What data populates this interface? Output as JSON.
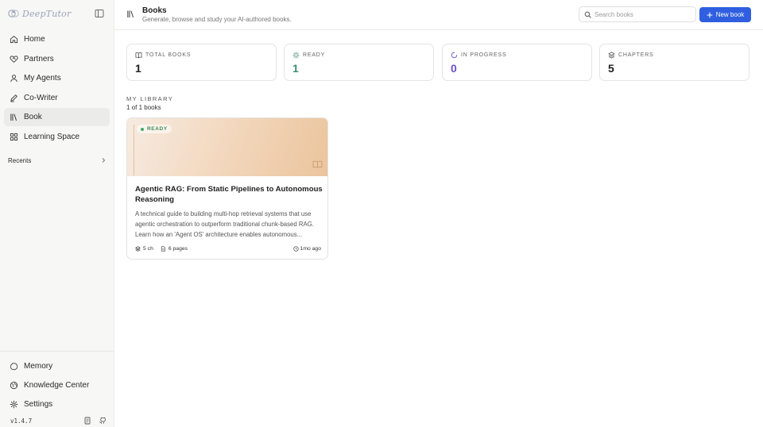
{
  "app": {
    "name": "DeepTutor",
    "version": "v1.4.7"
  },
  "sidebar": {
    "items": [
      {
        "label": "Home",
        "icon": "home-icon"
      },
      {
        "label": "Partners",
        "icon": "heart-handshake-icon"
      },
      {
        "label": "My Agents",
        "icon": "user-icon"
      },
      {
        "label": "Co-Writer",
        "icon": "pen-icon"
      },
      {
        "label": "Book",
        "icon": "library-icon",
        "active": true
      },
      {
        "label": "Learning Space",
        "icon": "grid-icon"
      }
    ],
    "recents_label": "Recents",
    "bottom_items": [
      {
        "label": "Memory",
        "icon": "memory-icon"
      },
      {
        "label": "Knowledge Center",
        "icon": "globe-icon"
      },
      {
        "label": "Settings",
        "icon": "gear-icon"
      }
    ]
  },
  "header": {
    "title": "Books",
    "subtitle": "Generate, browse and study your AI-authored books.",
    "search_placeholder": "Search books",
    "new_button_label": "New book",
    "accent_color": "#2f5fe0"
  },
  "stats": [
    {
      "label": "TOTAL BOOKS",
      "value": "1",
      "icon": "book-open-icon",
      "color": "#1f1f1f"
    },
    {
      "label": "READY",
      "value": "1",
      "icon": "sparkle-icon",
      "color": "#3f8a72"
    },
    {
      "label": "IN PROGRESS",
      "value": "0",
      "icon": "spinner-icon",
      "color": "#6a4fc9"
    },
    {
      "label": "CHAPTERS",
      "value": "5",
      "icon": "layers-icon",
      "color": "#1f1f1f"
    }
  ],
  "library": {
    "heading": "MY LIBRARY",
    "count_text": "1 of 1 books",
    "books": [
      {
        "status": "READY",
        "title": "Agentic RAG: From Static Pipelines to Autonomous Reasoning",
        "description": "A technical guide to building multi-hop retrieval systems that use agentic orchestration to outperform traditional chunk-based RAG. Learn how an 'Agent OS' architecture enables autonomous...",
        "chapters": "5 ch",
        "pages": "6 pages",
        "updated": "1mo ago"
      }
    ]
  }
}
